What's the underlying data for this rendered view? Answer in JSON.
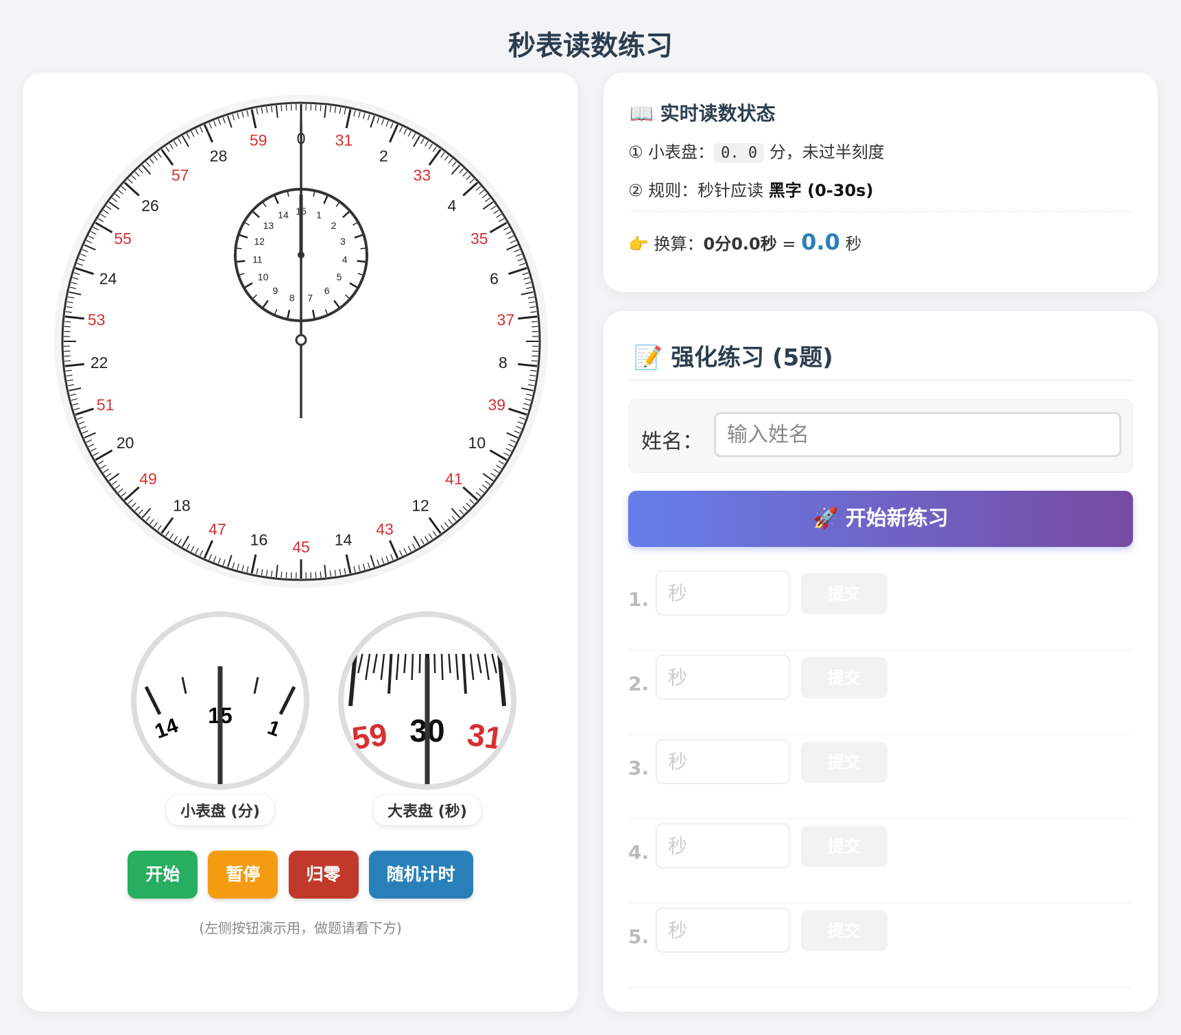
{
  "page": {
    "title": "秒表读数练习"
  },
  "stopwatch": {
    "minute_dial": {
      "labels": [
        "1",
        "2",
        "3",
        "4",
        "5",
        "6",
        "7",
        "8",
        "9",
        "10",
        "11",
        "12",
        "13",
        "14",
        "15"
      ],
      "hand_value": 0
    },
    "second_dial": {
      "black_labels": [
        "2",
        "4",
        "6",
        "8",
        "10",
        "12",
        "14",
        "16",
        "18",
        "20",
        "22",
        "24",
        "26",
        "28",
        "0"
      ],
      "red_labels": [
        "31",
        "33",
        "35",
        "37",
        "39",
        "41",
        "43",
        "45",
        "47",
        "49",
        "51",
        "53",
        "55",
        "57",
        "59"
      ],
      "hand_value": 0
    },
    "zoom_minute": {
      "label": "小表盘 (分)",
      "left_number": "14",
      "center_number": "15",
      "right_number": "1"
    },
    "zoom_second": {
      "label": "大表盘 (秒)",
      "left_number": "59",
      "center_number": "30",
      "right_number": "31"
    },
    "controls": {
      "start": "开始",
      "pause": "暂停",
      "reset": "归零",
      "random": "随机计时",
      "hint": "(左侧按钮演示用，做题请看下方)"
    },
    "colors": {
      "start": "#27ae60",
      "pause": "#f39c12",
      "reset": "#c0392b",
      "random": "#2980b9",
      "red_number": "#d63031"
    }
  },
  "status": {
    "icon": "📖",
    "title": "实时读数状态",
    "line1_prefix": "① 小表盘：",
    "line1_value": "0. 0",
    "line1_suffix": "分，未过半刻度",
    "line2_prefix": "② 规则：秒针应读 ",
    "line2_bold": "黑字 (0-30s)",
    "line3_icon": "👉",
    "line3_prefix": "换算：",
    "line3_bold": "0分0.0秒",
    "line3_eq": " = ",
    "line3_value": "0.0",
    "line3_unit": "秒"
  },
  "practice": {
    "icon": "📝",
    "title": "强化练习 (5题)",
    "name_label": "姓名：",
    "name_placeholder": "输入姓名",
    "start_button": "🚀 开始新练习",
    "questions": [
      {
        "num": "1.",
        "placeholder": "秒",
        "submit": "提交"
      },
      {
        "num": "2.",
        "placeholder": "秒",
        "submit": "提交"
      },
      {
        "num": "3.",
        "placeholder": "秒",
        "submit": "提交"
      },
      {
        "num": "4.",
        "placeholder": "秒",
        "submit": "提交"
      },
      {
        "num": "5.",
        "placeholder": "秒",
        "submit": "提交"
      }
    ]
  }
}
